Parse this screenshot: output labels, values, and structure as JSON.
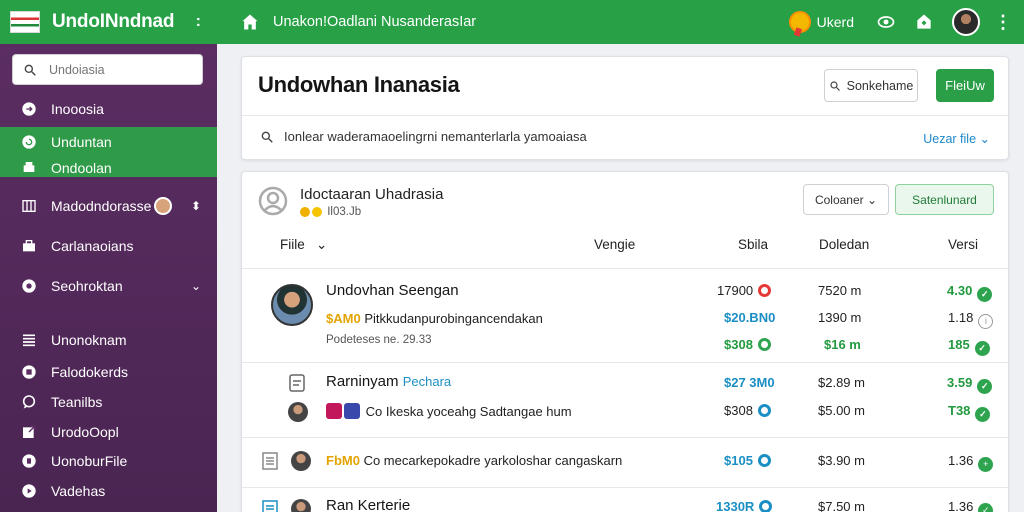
{
  "topbar": {
    "app_name": "UndoINndnad",
    "more": ":",
    "breadcrumb": "Unakon!Oadlani NusanderasIar",
    "user_label": "Ukerd",
    "dots": "⋮"
  },
  "sidebar": {
    "search_placeholder": "Undoiasia",
    "items": [
      {
        "label": "Inooosia"
      },
      {
        "label": "Unduntan"
      },
      {
        "label": "Ondoolan"
      },
      {
        "label": "Madodndorasse"
      },
      {
        "label": "Carlanaoians"
      },
      {
        "label": "Seohroktan"
      },
      {
        "label": "Unonoknam"
      },
      {
        "label": "Falodokerds"
      },
      {
        "label": "Teanilbs"
      },
      {
        "label": "UrodoOopl"
      },
      {
        "label": "UonoburFile"
      },
      {
        "label": "Vadehas"
      }
    ]
  },
  "header": {
    "title": "Undowhan Inanasia",
    "search_button": "Sonkehame",
    "primary_button": "FleiUw",
    "filter_text": "Ionlear waderamaoelingrni nemanterlarla yamoaiasa",
    "filter_link": "Uezar file"
  },
  "group": {
    "title": "Idoctaaran Uhadrasia",
    "subtitle": "Il03.Jb",
    "columns_button": "Coloaner",
    "save_button": "Satenlunard"
  },
  "table": {
    "headers": [
      "Fiile",
      "Vengie",
      "Sbila",
      "Doledan",
      "Versi"
    ],
    "rows": [
      {
        "title": "Undovhan Seengan",
        "badge": "$AM0",
        "desc": "Pitkkudanpurobingancendakan",
        "meta": "Podeteses ne. 29.33",
        "c1": "17900",
        "c2": "$20.BN0",
        "c3": "$308",
        "d1": "7520 m",
        "d2": "1390 m",
        "d3": "$16 m",
        "v1": "4.30",
        "v2": "1.18",
        "v3": "185"
      },
      {
        "title": "Rarninyam",
        "tag": "Pechara",
        "desc": "Co Ikeska yoceahg Sadtangae hum",
        "c1": "$27 3M0",
        "c2": "$308",
        "d1": "$2.89 m",
        "d2": "$5.00 m",
        "v1": "3.59",
        "v2": "T38"
      },
      {
        "badge": "FbM0",
        "desc": "Co mecarkepokadre yarkoloshar cangaskarn",
        "c1": "$105",
        "d1": "$3.90 m",
        "v1": "1.36"
      },
      {
        "title": "Ran Kerterie",
        "c1": "1330R",
        "d1": "$7.50 m",
        "v1": "1.36"
      }
    ]
  }
}
